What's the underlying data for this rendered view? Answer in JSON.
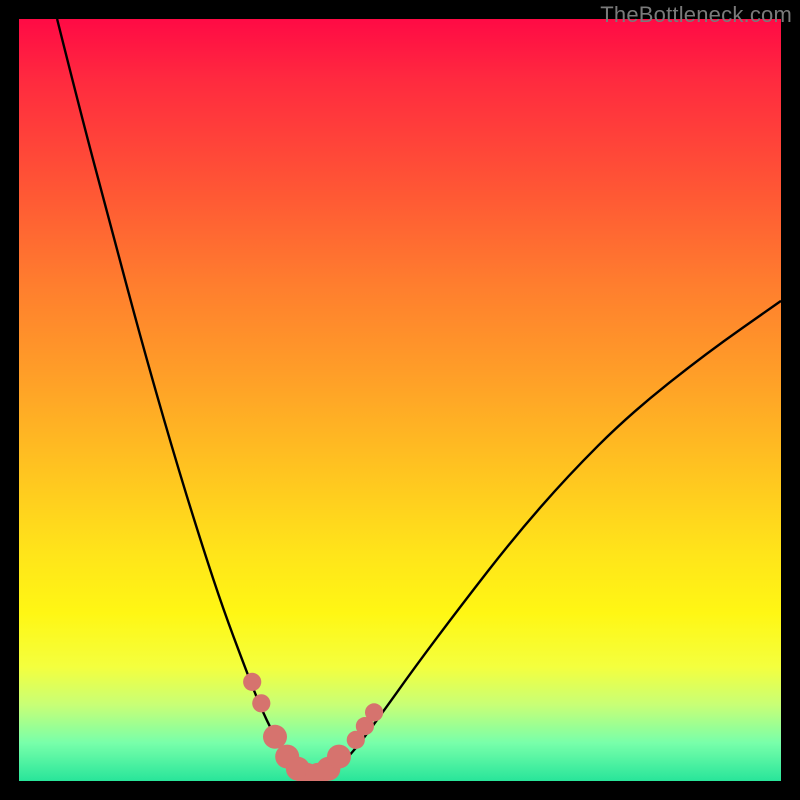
{
  "watermark": "TheBottleneck.com",
  "chart_data": {
    "type": "line",
    "title": "",
    "xlabel": "",
    "ylabel": "",
    "xlim": [
      0,
      100
    ],
    "ylim": [
      0,
      100
    ],
    "series": [
      {
        "name": "bottleneck-curve",
        "x": [
          5,
          8,
          12,
          16,
          20,
          24,
          27,
          30,
          32,
          34,
          36,
          37,
          38,
          39,
          40,
          42,
          44,
          47,
          52,
          58,
          65,
          72,
          80,
          90,
          100
        ],
        "y": [
          100,
          88,
          73,
          58,
          44,
          31,
          22,
          14,
          9,
          5,
          2,
          1,
          0.5,
          0.5,
          1,
          2,
          4,
          8,
          15,
          23,
          32,
          40,
          48,
          56,
          63
        ]
      }
    ],
    "markers": [
      {
        "x": 30.6,
        "y": 13.0,
        "r": 1.6
      },
      {
        "x": 31.8,
        "y": 10.2,
        "r": 1.6
      },
      {
        "x": 33.6,
        "y": 5.8,
        "r": 2.1
      },
      {
        "x": 35.2,
        "y": 3.2,
        "r": 2.1
      },
      {
        "x": 36.6,
        "y": 1.6,
        "r": 2.1
      },
      {
        "x": 37.8,
        "y": 0.8,
        "r": 2.1
      },
      {
        "x": 39.2,
        "y": 0.8,
        "r": 2.1
      },
      {
        "x": 40.6,
        "y": 1.6,
        "r": 2.1
      },
      {
        "x": 42.0,
        "y": 3.2,
        "r": 2.1
      },
      {
        "x": 44.2,
        "y": 5.4,
        "r": 1.6
      },
      {
        "x": 45.4,
        "y": 7.2,
        "r": 1.6
      },
      {
        "x": 46.6,
        "y": 9.0,
        "r": 1.6
      }
    ],
    "legend": false,
    "grid": false
  }
}
